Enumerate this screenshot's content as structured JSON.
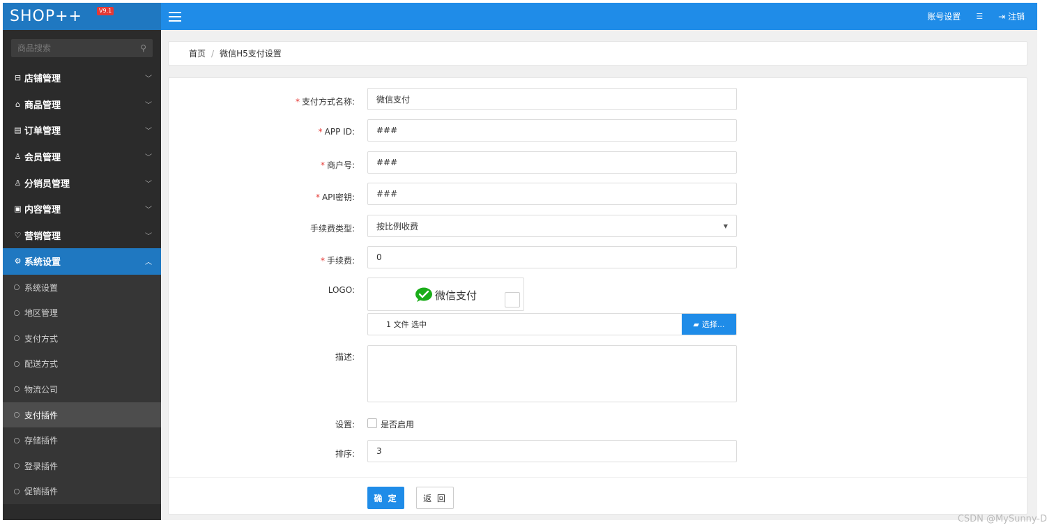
{
  "brand": {
    "name": "SHOP++",
    "version": "V9.1"
  },
  "search": {
    "placeholder": "商品搜索"
  },
  "menu": [
    {
      "icon": "store-icon",
      "glyph": "⊟",
      "label": "店铺管理",
      "expanded": false
    },
    {
      "icon": "bag-icon",
      "glyph": "⌂",
      "label": "商品管理",
      "expanded": false
    },
    {
      "icon": "order-icon",
      "glyph": "▤",
      "label": "订单管理",
      "expanded": false
    },
    {
      "icon": "user-icon",
      "glyph": "♙",
      "label": "会员管理",
      "expanded": false
    },
    {
      "icon": "users-icon",
      "glyph": "♙",
      "label": "分销员管理",
      "expanded": false
    },
    {
      "icon": "document-icon",
      "glyph": "▣",
      "label": "内容管理",
      "expanded": false
    },
    {
      "icon": "heart-icon",
      "glyph": "♡",
      "label": "营销管理",
      "expanded": false
    },
    {
      "icon": "gear-icon",
      "glyph": "⚙",
      "label": "系统设置",
      "expanded": true
    }
  ],
  "submenu": [
    {
      "label": "系统设置",
      "active": false
    },
    {
      "label": "地区管理",
      "active": false
    },
    {
      "label": "支付方式",
      "active": false
    },
    {
      "label": "配送方式",
      "active": false
    },
    {
      "label": "物流公司",
      "active": false
    },
    {
      "label": "支付插件",
      "active": true
    },
    {
      "label": "存储插件",
      "active": false
    },
    {
      "label": "登录插件",
      "active": false
    },
    {
      "label": "促销插件",
      "active": false
    }
  ],
  "topbar": {
    "account_settings": "账号设置",
    "logout": "注销"
  },
  "breadcrumb": {
    "home": "首页",
    "separator": "/",
    "current": "微信H5支付设置"
  },
  "form": {
    "name": {
      "label": "支付方式名称:",
      "value": "微信支付",
      "required": true
    },
    "app_id": {
      "label": "APP ID:",
      "value": "###",
      "required": true
    },
    "merchant_no": {
      "label": "商户号:",
      "value": "###",
      "required": true
    },
    "api_key": {
      "label": "API密钥:",
      "value": "###",
      "required": true
    },
    "fee_type": {
      "label": "手续费类型:",
      "value": "按比例收费",
      "required": false
    },
    "fee": {
      "label": "手续费:",
      "value": "0",
      "required": true
    },
    "logo": {
      "label": "LOGO:",
      "logo_text": "微信支付",
      "file_status": "1 文件 选中",
      "choose_button": "选择..."
    },
    "description": {
      "label": "描述:",
      "value": ""
    },
    "settings": {
      "label": "设置:",
      "checkbox_label": "是否启用",
      "checked": false
    },
    "order": {
      "label": "排序:",
      "value": "3"
    },
    "required_mark": "*",
    "submit": "确 定",
    "back": "返 回"
  },
  "watermark": "CSDN @MySunny-D",
  "colors": {
    "primary": "#1f8ce8",
    "sidebar": "#2b2b2b",
    "required": "#e53935",
    "wechat": "#1aad19"
  }
}
